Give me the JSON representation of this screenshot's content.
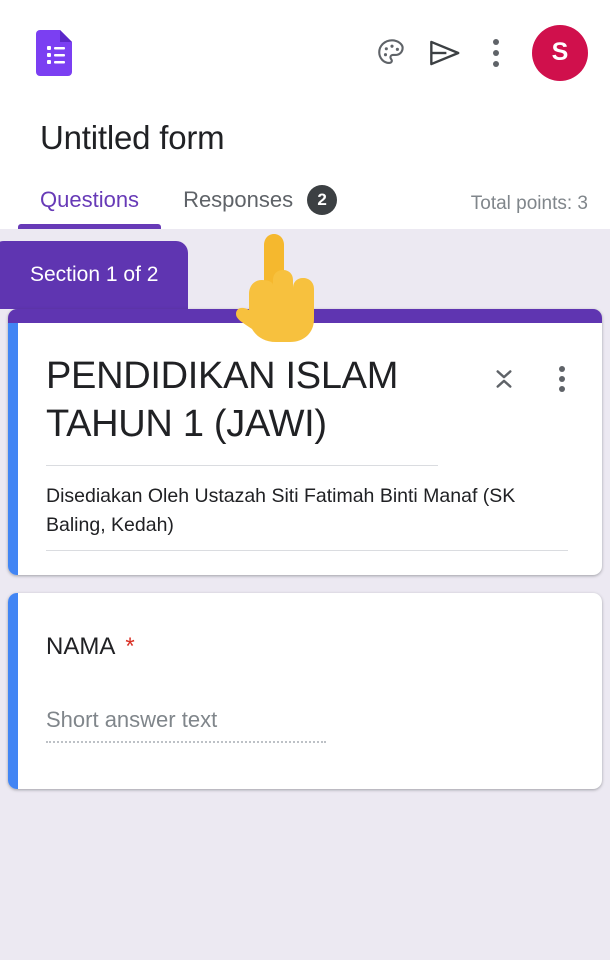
{
  "toolbar": {
    "app_icon": "google-forms-icon",
    "theme_label": "Customize theme",
    "preview_label": "Send",
    "more_label": "More options",
    "avatar_initial": "S",
    "avatar_color": "#d0104c"
  },
  "header": {
    "form_title": "Untitled form"
  },
  "tabs": [
    {
      "label": "Questions",
      "active": true,
      "badge": null
    },
    {
      "label": "Responses",
      "active": false,
      "badge": "2"
    }
  ],
  "total_points": "Total points: 3",
  "section": {
    "tab_label": "Section 1 of 2",
    "accent_color": "#5f35b1"
  },
  "header_card": {
    "title": "PENDIDIKAN ISLAM TAHUN 1 (JAWI)",
    "description": "Disediakan Oleh Ustazah Siti Fatimah Binti Manaf (SK Baling,  Kedah)",
    "accent_color": "#4285f4"
  },
  "question_card": {
    "title": "NAMA",
    "required_marker": "*",
    "answer_placeholder": "Short answer text",
    "accent_color": "#4285f4"
  },
  "cursor": {
    "type": "pointing-hand-emoji"
  },
  "colors": {
    "background": "#ece9f2",
    "primary_purple": "#673ab7",
    "section_purple": "#5f35b1",
    "badge_dark": "#3c4043",
    "required_red": "#d93025"
  }
}
